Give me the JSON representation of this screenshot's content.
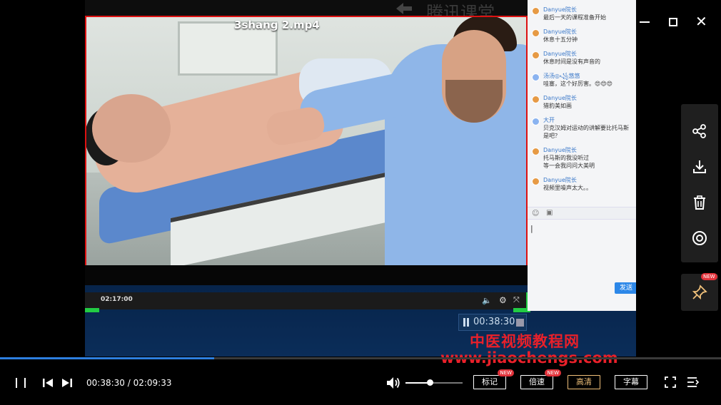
{
  "video": {
    "title": "3shang 2.mp4",
    "inner_brand": "腾讯课堂",
    "inner_time": "02:17:00",
    "inner_clock": "00:38:30"
  },
  "watermark": {
    "line1": "中医视频教程网",
    "line2": "www.jiaochengs.com"
  },
  "chat": {
    "messages": [
      {
        "sender": "Danyue院长",
        "text": "最后一天的课程准备开始",
        "avatar": "orange"
      },
      {
        "sender": "Danyue院长",
        "text": "休息十五分钟",
        "avatar": "orange"
      },
      {
        "sender": "Danyue院长",
        "text": "休息时间是没有声音的",
        "avatar": "orange"
      },
      {
        "sender": "汤汤◎꧁悠悠",
        "text": "哇塞，这个好厉害。😍😍😍",
        "avatar": "blue"
      },
      {
        "sender": "Danyue院长",
        "text": "猎豹美如画",
        "avatar": "orange"
      },
      {
        "sender": "大开",
        "text": "贝克汉姆对运动的讲解要比托马斯\n是吧？",
        "avatar": "blue"
      },
      {
        "sender": "Danyue院长",
        "text": "托马斯的我没听过\n等一会我问问大美明",
        "avatar": "orange"
      },
      {
        "sender": "Danyue院长",
        "text": "视频里噪声太大。。",
        "avatar": "orange"
      }
    ],
    "input_value": "|",
    "send_label": "发送"
  },
  "player": {
    "current_time": "00:38:30",
    "total_time": "02:09:33",
    "time_display": "00:38:30 / 02:09:33",
    "progress_fraction": 0.297,
    "volume_fraction": 0.42,
    "buttons": {
      "mark": "标记",
      "speed": "倍速",
      "hd": "高清",
      "subtitle": "字幕"
    },
    "new_badge": "NEW"
  },
  "side": {
    "pin_new": "NEW"
  },
  "colors": {
    "accent_blue": "#2d7fe0",
    "watermark_red": "#e8202a",
    "active_pill": "#f0c07a"
  }
}
